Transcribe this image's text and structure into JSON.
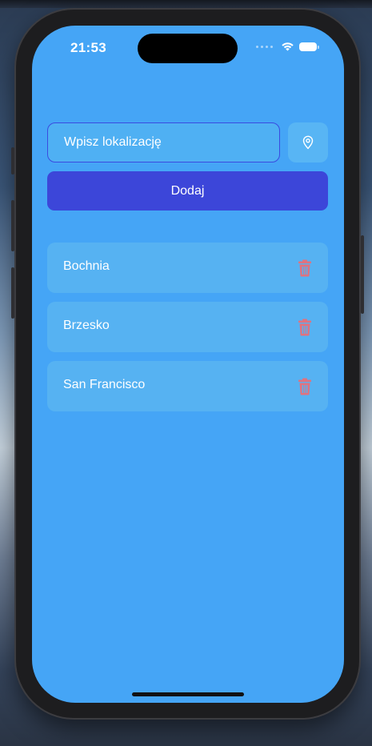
{
  "status_bar": {
    "time": "21:53"
  },
  "search": {
    "placeholder": "Wpisz lokalizację",
    "value": ""
  },
  "icons": {
    "location": "map-pin-icon",
    "delete": "trash-icon",
    "wifi": "wifi-icon",
    "battery": "battery-icon"
  },
  "add_button": {
    "label": "Dodaj"
  },
  "cities": [
    {
      "name": "Bochnia"
    },
    {
      "name": "Brzesko"
    },
    {
      "name": "San Francisco"
    }
  ],
  "colors": {
    "background": "#45a5f6",
    "primary_button": "#3c46d9",
    "input_border": "#3a4be0",
    "card": "#56b2f2",
    "delete_icon": "#e0727f"
  }
}
